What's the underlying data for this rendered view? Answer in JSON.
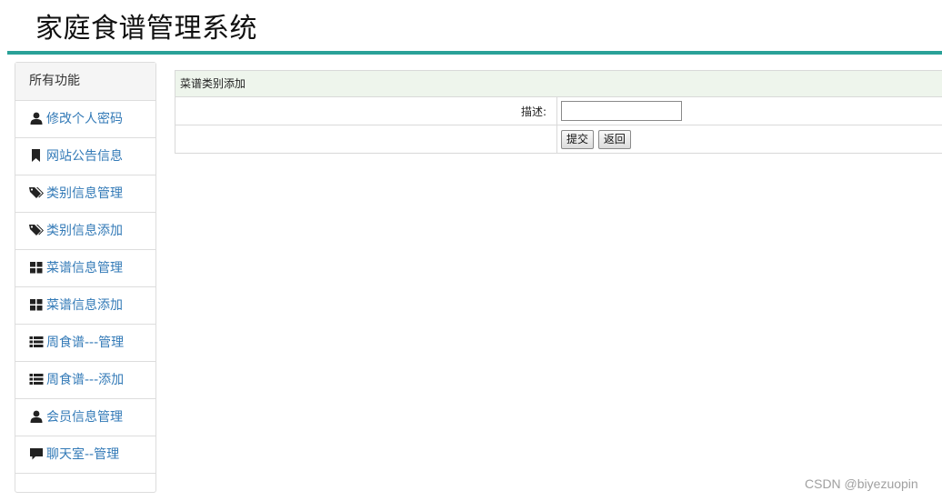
{
  "app": {
    "title": "家庭食谱管理系统"
  },
  "sidebar": {
    "heading": "所有功能",
    "items": [
      {
        "label": "修改个人密码",
        "icon": "user-icon"
      },
      {
        "label": "网站公告信息",
        "icon": "bookmark-icon"
      },
      {
        "label": "类别信息管理",
        "icon": "tags-icon"
      },
      {
        "label": "类别信息添加",
        "icon": "tags-icon"
      },
      {
        "label": "菜谱信息管理",
        "icon": "grid-icon"
      },
      {
        "label": "菜谱信息添加",
        "icon": "grid-icon"
      },
      {
        "label": "周食谱---管理",
        "icon": "list-icon"
      },
      {
        "label": "周食谱---添加",
        "icon": "list-icon"
      },
      {
        "label": "会员信息管理",
        "icon": "user-icon"
      },
      {
        "label": "聊天室--管理",
        "icon": "comment-icon"
      }
    ]
  },
  "form": {
    "heading": "菜谱类别添加",
    "description_label": "描述:",
    "description_value": "",
    "submit_label": "提交",
    "back_label": "返回"
  },
  "watermark": "CSDN @biyezuopin",
  "colors": {
    "header_rule": "#2aa198",
    "link": "#337ab7",
    "form_heading_bg": "#eef5ec"
  }
}
